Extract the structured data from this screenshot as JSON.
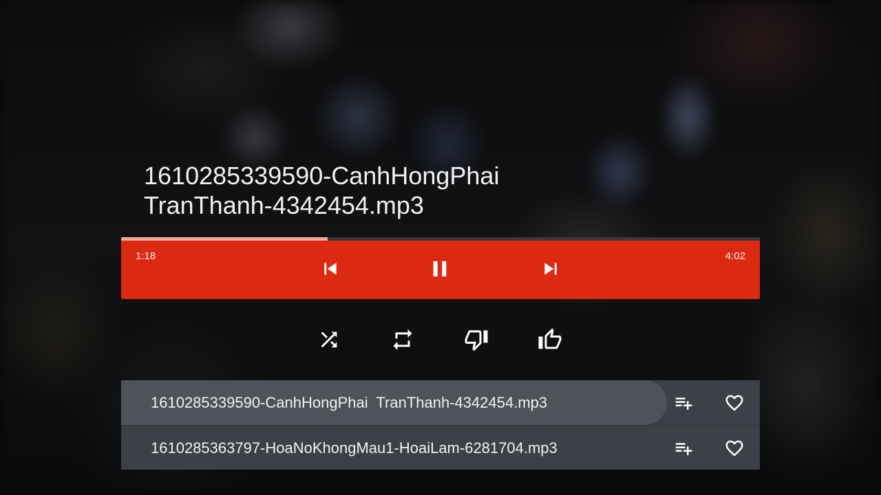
{
  "now_playing": {
    "title_line1": "1610285339590-CanhHongPhai",
    "title_line2": "TranThanh-4342454.mp3"
  },
  "player": {
    "current_time": "1:18",
    "total_time": "4:02",
    "progress_fraction": 0.323,
    "accent_color": "#dc2a12",
    "controls": [
      {
        "icon": "skip-previous-icon",
        "action": "previous"
      },
      {
        "icon": "pause-icon",
        "action": "pause"
      },
      {
        "icon": "skip-next-icon",
        "action": "next"
      }
    ]
  },
  "secondary_controls": [
    {
      "icon": "shuffle-icon"
    },
    {
      "icon": "repeat-icon"
    },
    {
      "icon": "thumbs-down-icon"
    },
    {
      "icon": "thumbs-up-icon"
    }
  ],
  "playlist": {
    "tracks": [
      {
        "name": "1610285339590-CanhHongPhai  TranThanh-4342454.mp3",
        "selected": true
      },
      {
        "name": "1610285363797-HoaNoKhongMau1-HoaiLam-6281704.mp3",
        "selected": false
      }
    ],
    "row_actions": [
      {
        "icon": "playlist-add-icon"
      },
      {
        "icon": "heart-outline-icon"
      }
    ]
  }
}
